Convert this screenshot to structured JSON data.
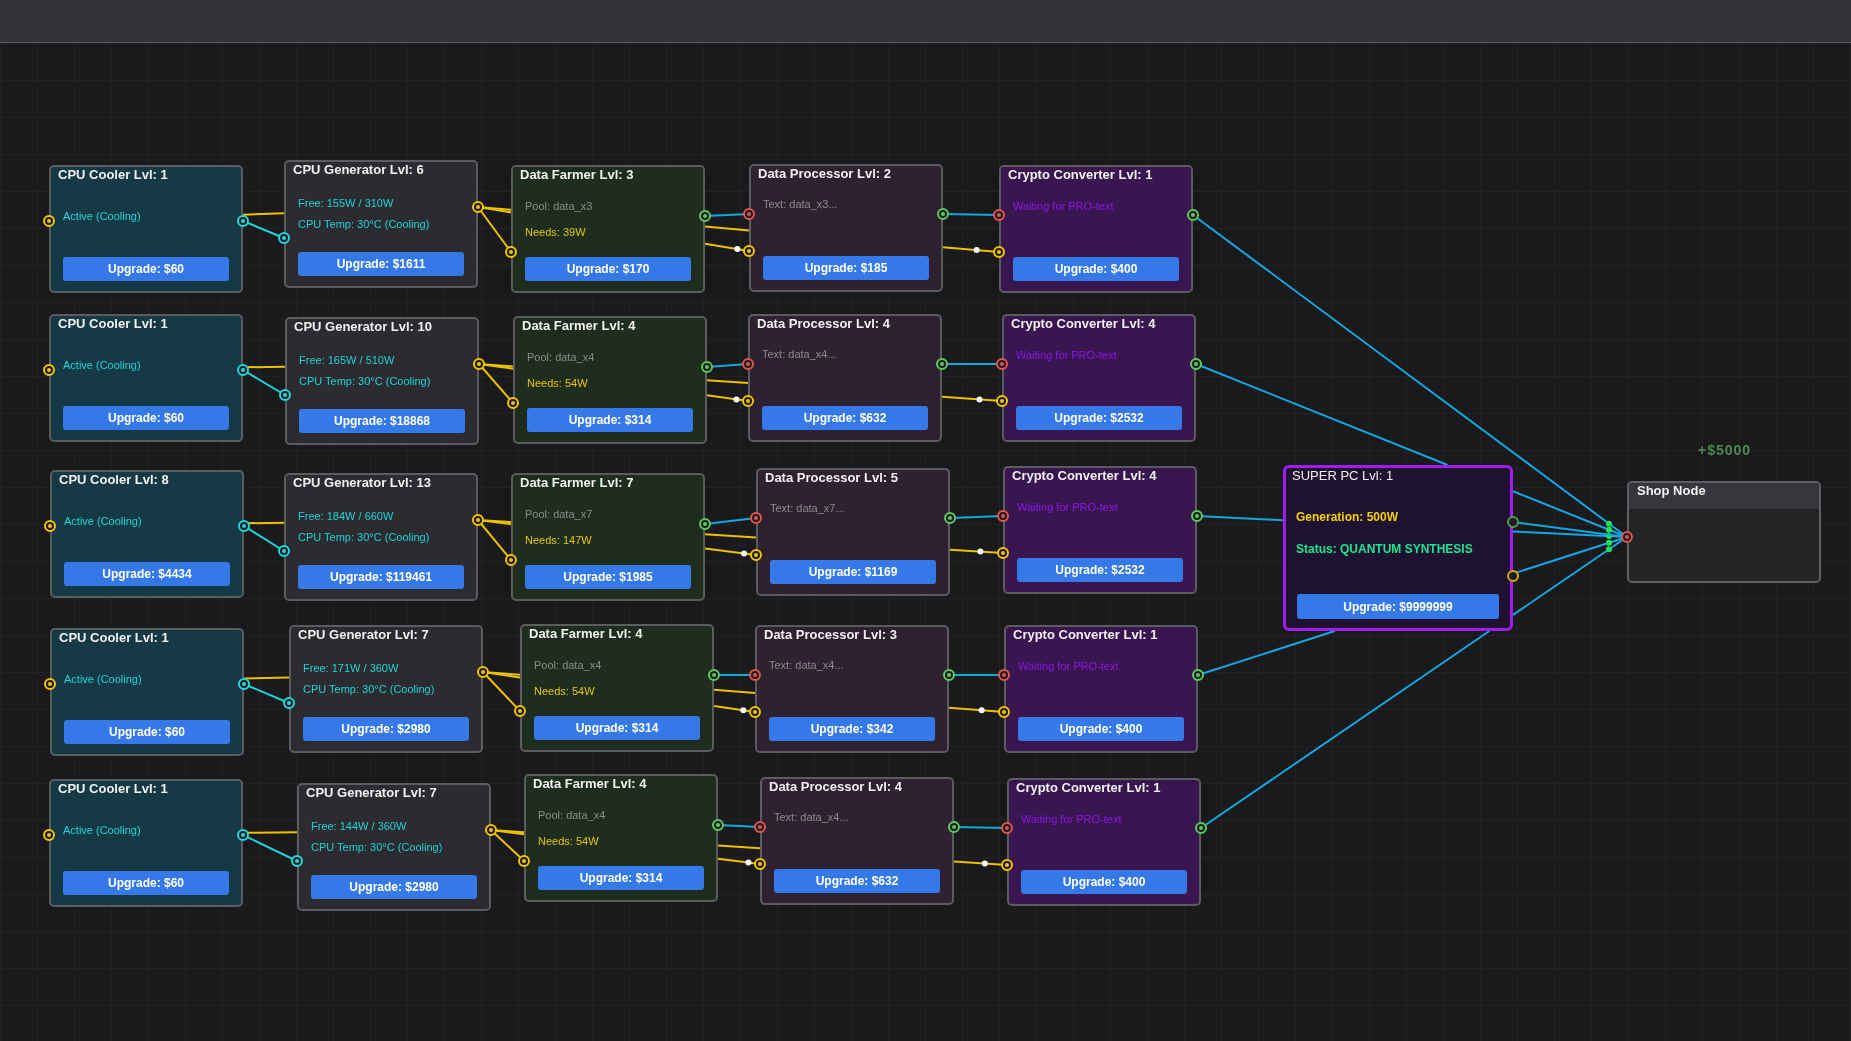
{
  "canvas": {
    "rows": [
      {
        "nodes": [
          {
            "kind": "cooler",
            "title": "CPU Cooler Lvl: 1",
            "lines": [
              {
                "kind": "status",
                "text": "Active (Cooling)"
              }
            ],
            "upgrade": "Upgrade: $60"
          },
          {
            "kind": "generator",
            "title": "CPU Generator Lvl: 6",
            "lines": [
              {
                "kind": "power",
                "text": "Free: 155W / 310W"
              },
              {
                "kind": "temperature",
                "text": "CPU Temp: 30°C (Cooling)"
              }
            ],
            "upgrade": "Upgrade: $1611"
          },
          {
            "kind": "farmer",
            "title": "Data Farmer Lvl: 3",
            "lines": [
              {
                "kind": "pool",
                "text": "Pool: data_x3"
              },
              {
                "kind": "demand",
                "text": "Needs: 39W"
              }
            ],
            "upgrade": "Upgrade: $170"
          },
          {
            "kind": "processor",
            "title": "Data Processor Lvl: 2",
            "lines": [
              {
                "kind": "text",
                "text": "Text: data_x3..."
              }
            ],
            "upgrade": "Upgrade: $185"
          },
          {
            "kind": "converter",
            "title": "Crypto Converter Lvl: 1",
            "lines": [
              {
                "kind": "waiting",
                "text": "Waiting for PRO-text"
              }
            ],
            "upgrade": "Upgrade: $400"
          }
        ]
      },
      {
        "nodes": [
          {
            "kind": "cooler",
            "title": "CPU Cooler Lvl: 1",
            "lines": [
              {
                "kind": "status",
                "text": "Active (Cooling)"
              }
            ],
            "upgrade": "Upgrade: $60"
          },
          {
            "kind": "generator",
            "title": "CPU Generator Lvl: 10",
            "lines": [
              {
                "kind": "power",
                "text": "Free: 165W / 510W"
              },
              {
                "kind": "temperature",
                "text": "CPU Temp: 30°C (Cooling)"
              }
            ],
            "upgrade": "Upgrade: $18868"
          },
          {
            "kind": "farmer",
            "title": "Data Farmer Lvl: 4",
            "lines": [
              {
                "kind": "pool",
                "text": "Pool: data_x4"
              },
              {
                "kind": "demand",
                "text": "Needs: 54W"
              }
            ],
            "upgrade": "Upgrade: $314"
          },
          {
            "kind": "processor",
            "title": "Data Processor Lvl: 4",
            "lines": [
              {
                "kind": "text",
                "text": "Text: data_x4..."
              }
            ],
            "upgrade": "Upgrade: $632"
          },
          {
            "kind": "converter",
            "title": "Crypto Converter Lvl: 4",
            "lines": [
              {
                "kind": "waiting",
                "text": "Waiting for PRO-text"
              }
            ],
            "upgrade": "Upgrade: $2532"
          }
        ]
      },
      {
        "nodes": [
          {
            "kind": "cooler",
            "title": "CPU Cooler Lvl: 8",
            "lines": [
              {
                "kind": "status",
                "text": "Active (Cooling)"
              }
            ],
            "upgrade": "Upgrade: $4434"
          },
          {
            "kind": "generator",
            "title": "CPU Generator Lvl: 13",
            "lines": [
              {
                "kind": "power",
                "text": "Free: 184W / 660W"
              },
              {
                "kind": "temperature",
                "text": "CPU Temp: 30°C (Cooling)"
              }
            ],
            "upgrade": "Upgrade: $119461"
          },
          {
            "kind": "farmer",
            "title": "Data Farmer Lvl: 7",
            "lines": [
              {
                "kind": "pool",
                "text": "Pool: data_x7"
              },
              {
                "kind": "demand",
                "text": "Needs: 147W"
              }
            ],
            "upgrade": "Upgrade: $1985"
          },
          {
            "kind": "processor",
            "title": "Data Processor Lvl: 5",
            "lines": [
              {
                "kind": "text",
                "text": "Text: data_x7..."
              }
            ],
            "upgrade": "Upgrade: $1169"
          },
          {
            "kind": "converter",
            "title": "Crypto Converter Lvl: 4",
            "lines": [
              {
                "kind": "waiting",
                "text": "Waiting for PRO-text"
              }
            ],
            "upgrade": "Upgrade: $2532"
          }
        ]
      },
      {
        "nodes": [
          {
            "kind": "cooler",
            "title": "CPU Cooler Lvl: 1",
            "lines": [
              {
                "kind": "status",
                "text": "Active (Cooling)"
              }
            ],
            "upgrade": "Upgrade: $60"
          },
          {
            "kind": "generator",
            "title": "CPU Generator Lvl: 7",
            "lines": [
              {
                "kind": "power",
                "text": "Free: 171W / 360W"
              },
              {
                "kind": "temperature",
                "text": "CPU Temp: 30°C (Cooling)"
              }
            ],
            "upgrade": "Upgrade: $2980"
          },
          {
            "kind": "farmer",
            "title": "Data Farmer Lvl: 4",
            "lines": [
              {
                "kind": "pool",
                "text": "Pool: data_x4"
              },
              {
                "kind": "demand",
                "text": "Needs: 54W"
              }
            ],
            "upgrade": "Upgrade: $314"
          },
          {
            "kind": "processor",
            "title": "Data Processor Lvl: 3",
            "lines": [
              {
                "kind": "text",
                "text": "Text: data_x4..."
              }
            ],
            "upgrade": "Upgrade: $342"
          },
          {
            "kind": "converter",
            "title": "Crypto Converter Lvl: 1",
            "lines": [
              {
                "kind": "waiting",
                "text": "Waiting for PRO-text"
              }
            ],
            "upgrade": "Upgrade: $400"
          }
        ]
      },
      {
        "nodes": [
          {
            "kind": "cooler",
            "title": "CPU Cooler Lvl: 1",
            "lines": [
              {
                "kind": "status",
                "text": "Active (Cooling)"
              }
            ],
            "upgrade": "Upgrade: $60"
          },
          {
            "kind": "generator",
            "title": "CPU Generator Lvl: 7",
            "lines": [
              {
                "kind": "power",
                "text": "Free: 144W / 360W"
              },
              {
                "kind": "temperature",
                "text": "CPU Temp: 30°C (Cooling)"
              }
            ],
            "upgrade": "Upgrade: $2980"
          },
          {
            "kind": "farmer",
            "title": "Data Farmer Lvl: 4",
            "lines": [
              {
                "kind": "pool",
                "text": "Pool: data_x4"
              },
              {
                "kind": "demand",
                "text": "Needs: 54W"
              }
            ],
            "upgrade": "Upgrade: $314"
          },
          {
            "kind": "processor",
            "title": "Data Processor Lvl: 4",
            "lines": [
              {
                "kind": "text",
                "text": "Text: data_x4..."
              }
            ],
            "upgrade": "Upgrade: $632"
          },
          {
            "kind": "converter",
            "title": "Crypto Converter Lvl: 1",
            "lines": [
              {
                "kind": "waiting",
                "text": "Waiting for PRO-text"
              }
            ],
            "upgrade": "Upgrade: $400"
          }
        ]
      }
    ],
    "super_pc": {
      "title": "SUPER PC Lvl: 1",
      "lines": [
        {
          "kind": "generation",
          "text": "Generation: 500W"
        },
        {
          "kind": "mode",
          "text": "Status: QUANTUM SYNTHESIS"
        }
      ],
      "upgrade": "Upgrade: $9999999"
    },
    "income_popup": "+$5000",
    "shop_node": {
      "title": "Shop Node"
    }
  }
}
